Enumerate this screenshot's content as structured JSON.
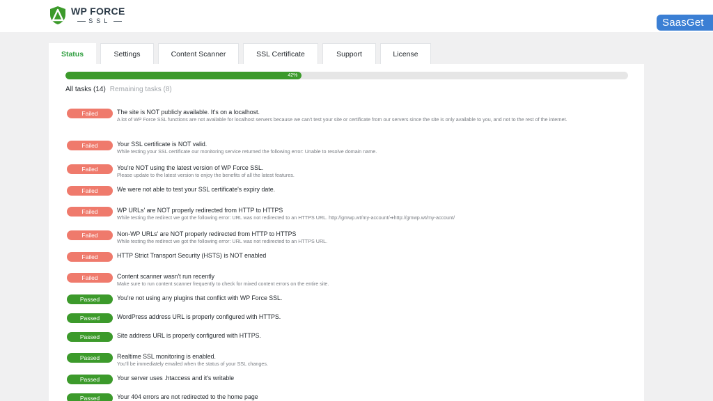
{
  "header": {
    "logo_title": "WP FORCE",
    "logo_sub": "SSL",
    "badge": "SaasGet"
  },
  "tabs": [
    {
      "label": "Status",
      "active": true
    },
    {
      "label": "Settings"
    },
    {
      "label": "Content Scanner"
    },
    {
      "label": "SSL Certificate"
    },
    {
      "label": "Support"
    },
    {
      "label": "License"
    }
  ],
  "progress": {
    "label": "42%",
    "value": 0.42
  },
  "filters": {
    "all": "All tasks (14)",
    "remaining": "Remaining tasks (8)"
  },
  "colors": {
    "failed": "#ef7a6c",
    "passed": "#3c9a2b",
    "active_tab": "#2e9e3e",
    "badge": "#3b7fd4"
  },
  "tasks": [
    {
      "status": "Failed",
      "title": "The site is NOT publicly available. It's on a localhost.",
      "desc": "A lot of WP Force SSL functions are not available for localhost servers because we can't test your site or certificate from our servers since the site is only available to you, and not to the rest of the internet."
    },
    {
      "status": "Failed",
      "title": "Your SSL certificate is NOT valid.",
      "desc": "While testing your SSL certificate our monitoring service returned the following error: Unable to resolve domain name."
    },
    {
      "status": "Failed",
      "title": "You're NOT using the latest version of WP Force SSL.",
      "desc": "Please update to the latest version to enjoy the benefits of all the latest features."
    },
    {
      "status": "Failed",
      "title": "We were not able to test your SSL certificate's expiry date.",
      "desc": ""
    },
    {
      "status": "Failed",
      "title": "WP URLs' are NOT properly redirected from HTTP to HTTPS",
      "desc": "While testing the redirect we got the following error: URL was not redirected to an HTTPS URL. http://gmwp.wt/my-account/➔http://gmwp.wt/my-account/"
    },
    {
      "status": "Failed",
      "title": "Non-WP URLs' are NOT properly redirected from HTTP to HTTPS",
      "desc": "While testing the redirect we got the following error: URL was not redirected to an HTTPS URL."
    },
    {
      "status": "Failed",
      "title": "HTTP Strict Transport Security (HSTS) is NOT enabled",
      "desc": ""
    },
    {
      "status": "Failed",
      "title": "Content scanner wasn't run recently",
      "desc": "Make sure to run content scanner frequently to check for mixed content errors on the entire site."
    },
    {
      "status": "Passed",
      "title": "You're not using any plugins that conflict with WP Force SSL.",
      "desc": ""
    },
    {
      "status": "Passed",
      "title": "WordPress address URL is properly configured with HTTPS.",
      "desc": ""
    },
    {
      "status": "Passed",
      "title": "Site address URL is properly configured with HTTPS.",
      "desc": ""
    },
    {
      "status": "Passed",
      "title": "Realtime SSL monitoring is enabled.",
      "desc": "You'll be immediately emailed when the status of your SSL changes."
    },
    {
      "status": "Passed",
      "title": "Your server uses .htaccess and it's writable",
      "desc": ""
    },
    {
      "status": "Passed",
      "title": "Your 404 errors are not redirected to the home page",
      "desc": ""
    }
  ]
}
